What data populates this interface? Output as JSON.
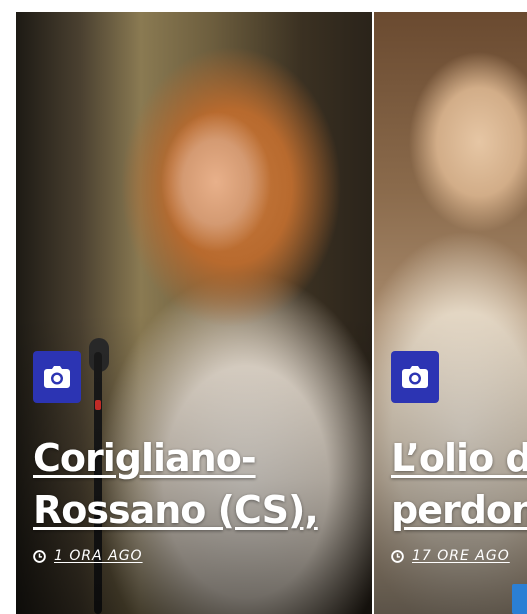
{
  "articles": [
    {
      "title_line1": "Corigliano-",
      "title_line2": "Rossano (CS),",
      "time": "1 ORA AGO",
      "badge_icon": "camera-icon"
    },
    {
      "title_line1": "L’olio d",
      "title_line2": "perdon",
      "time": "17 ORE AGO",
      "badge_icon": "camera-icon"
    }
  ],
  "colors": {
    "badge": "#2c34b3",
    "text": "#ffffff",
    "accent": "#2b7fd4"
  }
}
